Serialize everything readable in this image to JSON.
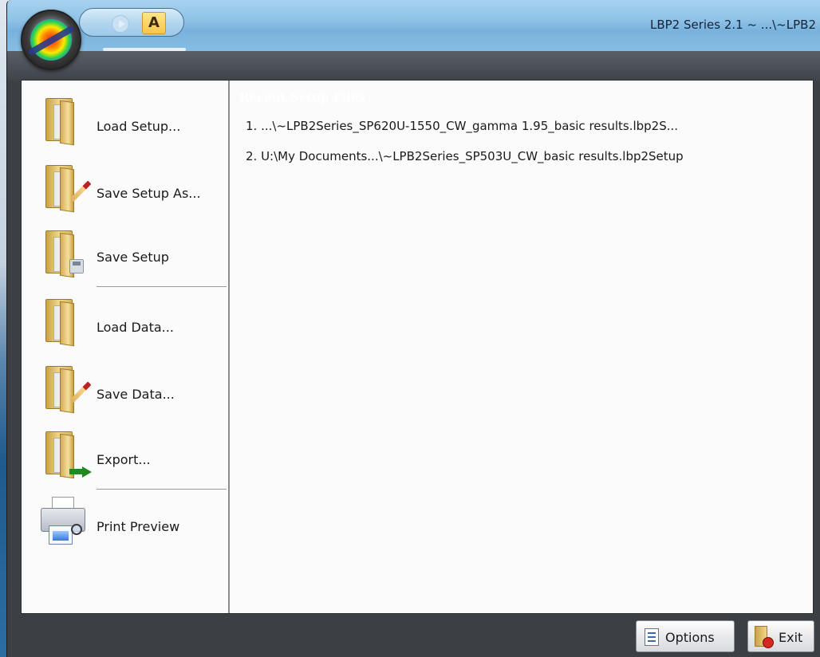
{
  "window": {
    "title": "LBP2 Series 2.1 ~ ...\\~LPB2"
  },
  "quick_access": {
    "play_icon": "play-icon",
    "annotate_icon": "annotate-icon",
    "annotate_glyph": "A"
  },
  "menu": {
    "commands": [
      {
        "label": "Load Setup...",
        "icon": "folder-icon"
      },
      {
        "label": "Save Setup As...",
        "icon": "folder-edit-icon"
      },
      {
        "label": "Save Setup",
        "icon": "folder-save-icon"
      },
      {
        "label": "Load Data...",
        "icon": "folder-icon"
      },
      {
        "label": "Save Data...",
        "icon": "folder-edit-icon"
      },
      {
        "label": "Export...",
        "icon": "folder-export-icon"
      },
      {
        "label": "Print Preview",
        "icon": "print-preview-icon"
      }
    ]
  },
  "recent": {
    "header": "Recent Setup Files",
    "items": [
      "1. ...\\~LPB2Series_SP620U-1550_CW_gamma 1.95_basic results.lbp2S...",
      "2. U:\\My Documents...\\~LPB2Series_SP503U_CW_basic results.lbp2Setup"
    ]
  },
  "footer": {
    "options_label": "Options",
    "exit_label": "Exit"
  },
  "colors": {
    "title_bar": "#8ec2e6",
    "frame": "#3c3f44",
    "panel": "#fbfbfb"
  }
}
